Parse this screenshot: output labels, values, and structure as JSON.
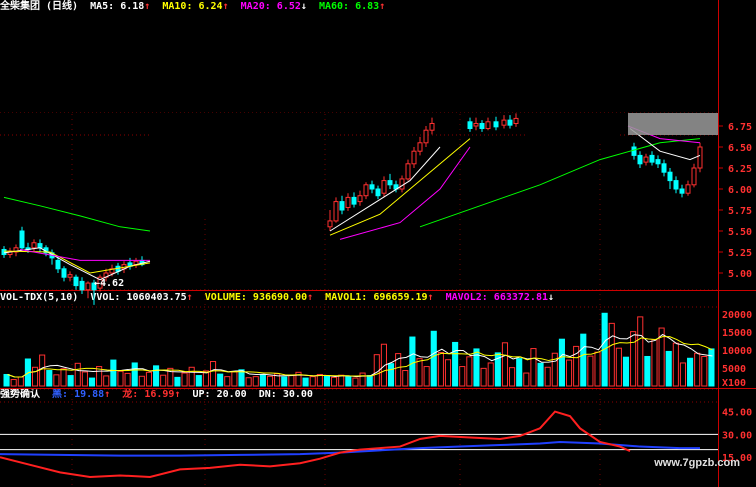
{
  "price_header": {
    "title": "全柴集团",
    "period": "(日线)",
    "ma5_label": "MA5:",
    "ma5_value": "6.18",
    "ma5_arrow": "↑",
    "ma10_label": "MA10:",
    "ma10_value": "6.24",
    "ma10_arrow": "↑",
    "ma20_label": "MA20:",
    "ma20_value": "6.52",
    "ma20_arrow": "↓",
    "ma60_label": "MA60:",
    "ma60_value": "6.83",
    "ma60_arrow": "↑"
  },
  "price_axis": [
    "6.75",
    "6.50",
    "6.25",
    "6.00",
    "5.75",
    "5.50",
    "5.25",
    "5.00"
  ],
  "low_marker": "←4.62",
  "vol_header": {
    "name": "VOL-TDX(5,10)",
    "vvol_label": "VVOL:",
    "vvol_value": "1060403.75",
    "vvol_arrow": "↑",
    "volume_label": "VOLUME:",
    "volume_value": "936690.00",
    "volume_arrow": "↑",
    "mavol1_label": "MAVOL1:",
    "mavol1_value": "696659.19",
    "mavol1_arrow": "↑",
    "mavol2_label": "MAVOL2:",
    "mavol2_value": "663372.81",
    "mavol2_arrow": "↓"
  },
  "vol_axis": [
    "20000",
    "15000",
    "10000",
    "5000",
    "X100"
  ],
  "ind_header": {
    "name": "强势确认",
    "line1_label": "黑:",
    "line1_value": "19.88",
    "line1_arrow": "↑",
    "line2_label": "龙:",
    "line2_value": "16.99",
    "line2_arrow": "↑",
    "up_label": "UP:",
    "up_value": "20.00",
    "dn_label": "DN:",
    "dn_value": "30.00"
  },
  "ind_axis": [
    "45.00",
    "30.00",
    "15.00"
  ],
  "watermark": "www.7gpzb.com",
  "colors": {
    "up": "#ff3030",
    "down": "#00ffff",
    "ma5": "#ffffff",
    "ma10": "#ffff00",
    "ma20": "#ff00ff",
    "ma60": "#00ff00"
  },
  "chart_data": [
    {
      "type": "candlestick",
      "title": "全柴集团 (日线)",
      "ylim": [
        4.62,
        6.9
      ],
      "series": [
        {
          "name": "MA5",
          "values": [
            6.18
          ]
        },
        {
          "name": "MA10",
          "values": [
            6.24
          ]
        },
        {
          "name": "MA20",
          "values": [
            6.52
          ]
        },
        {
          "name": "MA60",
          "values": [
            6.83
          ]
        }
      ],
      "annotations": [
        "←4.62"
      ]
    },
    {
      "type": "bar",
      "title": "VOL-TDX(5,10)",
      "ylabel": "X100",
      "ylim": [
        0,
        22000
      ],
      "series": [
        {
          "name": "VOLUME",
          "values": [
            936690.0
          ]
        },
        {
          "name": "MAVOL1",
          "values": [
            696659.19
          ]
        },
        {
          "name": "MAVOL2",
          "values": [
            663372.81
          ]
        }
      ]
    },
    {
      "type": "line",
      "title": "强势确认",
      "ylim": [
        0,
        50
      ],
      "series": [
        {
          "name": "黑",
          "values": [
            19.88
          ]
        },
        {
          "name": "龙",
          "values": [
            16.99
          ]
        }
      ]
    }
  ]
}
